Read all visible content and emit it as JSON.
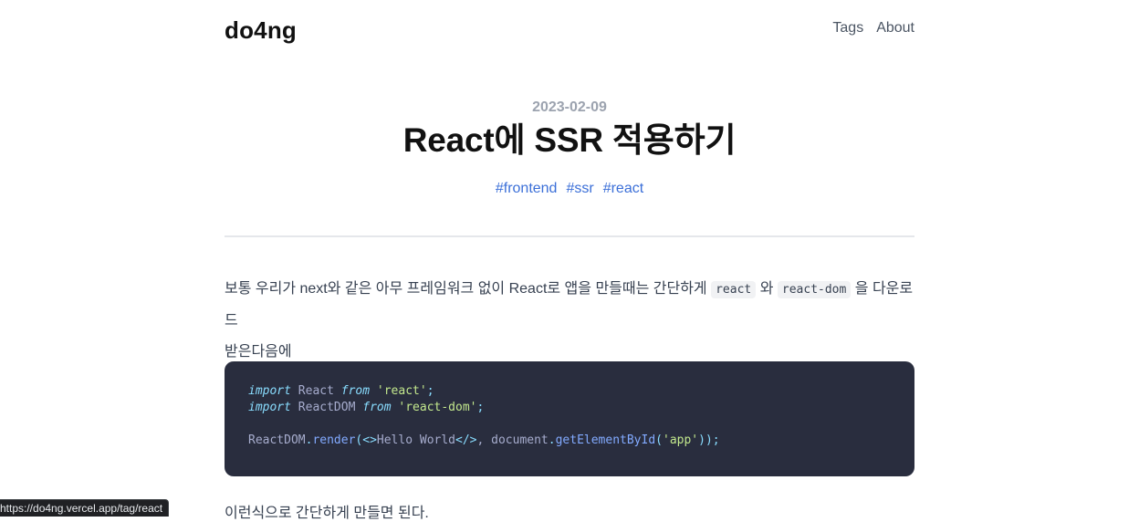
{
  "header": {
    "brand": "do4ng",
    "nav": [
      {
        "label": "Tags"
      },
      {
        "label": "About"
      }
    ]
  },
  "post": {
    "date": "2023-02-09",
    "title": "React에 SSR 적용하기",
    "tags": [
      "#frontend",
      "#ssr",
      "#react"
    ]
  },
  "content": {
    "para1_a": "보통 우리가 next와 같은 아무 프레임워크 없이 React로 앱을 만들때는 간단하게",
    "code1": "react",
    "para1_b": "와",
    "code2": "react-dom",
    "para1_c": "을 다운로드",
    "para1_d": "받은다음에",
    "code_block": {
      "l1_kw": "import",
      "l1_id": " React ",
      "l1_from": "from",
      "l1_str": "'react'",
      "l1_end": ";",
      "l2_kw": "import",
      "l2_id": " ReactDOM ",
      "l2_from": "from",
      "l2_str": "'react-dom'",
      "l2_end": ";",
      "l4_obj": "ReactDOM",
      "l4_dot": ".",
      "l4_fn": "render",
      "l4_p1": "(<>",
      "l4_txt": "Hello World",
      "l4_p2": "</>",
      "l4_c": ", document",
      "l4_dot2": ".",
      "l4_fn2": "getElementById",
      "l4_p3": "(",
      "l4_str": "'app'",
      "l4_p4": "));"
    },
    "after_text": "이런식으로 간단하게 만들면 된다."
  },
  "status_bar": {
    "url": "https://do4ng.vercel.app/tag/react"
  }
}
